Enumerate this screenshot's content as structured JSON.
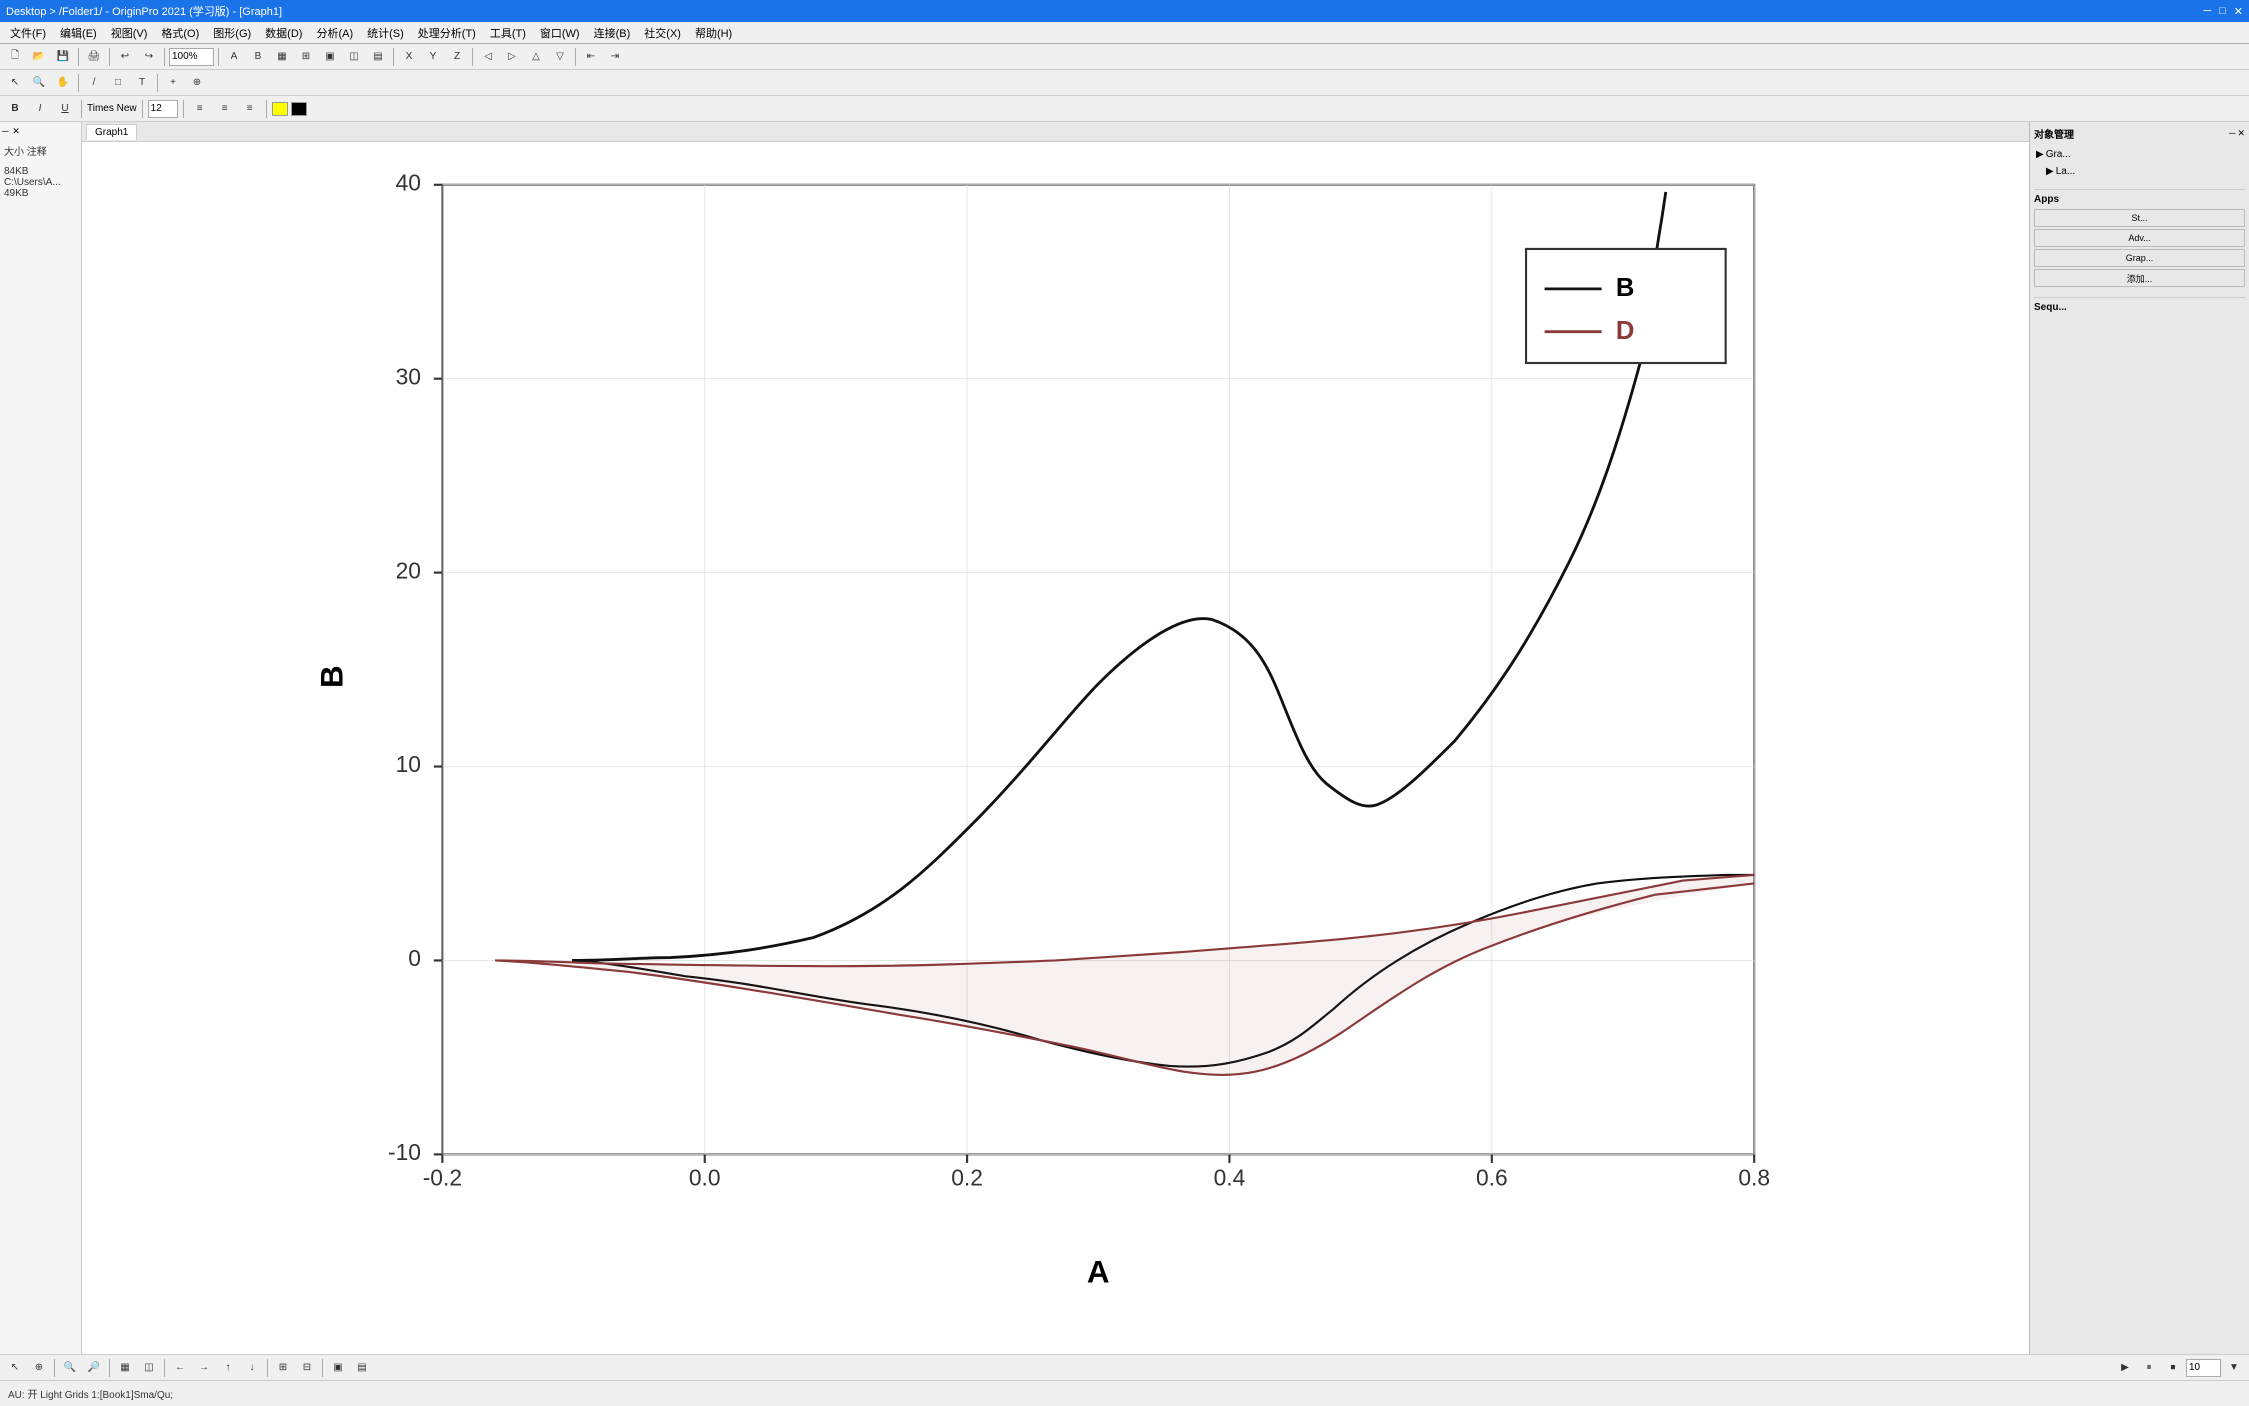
{
  "titlebar": {
    "text": "Desktop > /Folder1/ - OriginPro 2021 (学习版) - [Graph1]"
  },
  "menubar": {
    "items": [
      "文件(F)",
      "编辑(E)",
      "视图(V)",
      "格式(O)",
      "图形(G)",
      "数据(D)",
      "分析(A)",
      "统计(S)",
      "处理分析(T)",
      "工具(T)",
      "窗口(W)",
      "连接(B)",
      "帮助(H)"
    ]
  },
  "toolbar1": {
    "zoom": "100%"
  },
  "graph": {
    "title": "Graph1",
    "x_label": "A",
    "y_label": "B",
    "x_min": "-0.2",
    "x_max": "0.8",
    "y_min": "-10",
    "y_max": "40",
    "x_ticks": [
      "-0.2",
      "0.0",
      "0.2",
      "0.4",
      "0.6",
      "0.8"
    ],
    "y_ticks": [
      "-10",
      "0",
      "10",
      "20",
      "30",
      "40"
    ],
    "legend": {
      "items": [
        {
          "label": "B",
          "color": "#000000",
          "type": "line"
        },
        {
          "label": "D",
          "color": "#8b3a3a",
          "type": "line"
        }
      ]
    }
  },
  "leftpanel": {
    "size_label": "大小",
    "note_label": "注释",
    "size_value": "84KB",
    "path_value": "C:\\Users\\A...",
    "extra_value": "49KB"
  },
  "statusbar": {
    "text": "AU: 开  Light Grids  1:[Book1]Sma/Qu;"
  },
  "apps_panel": {
    "labels": [
      "Apps",
      "St...",
      "Adv...",
      "Grap...",
      "Sequ..."
    ]
  }
}
